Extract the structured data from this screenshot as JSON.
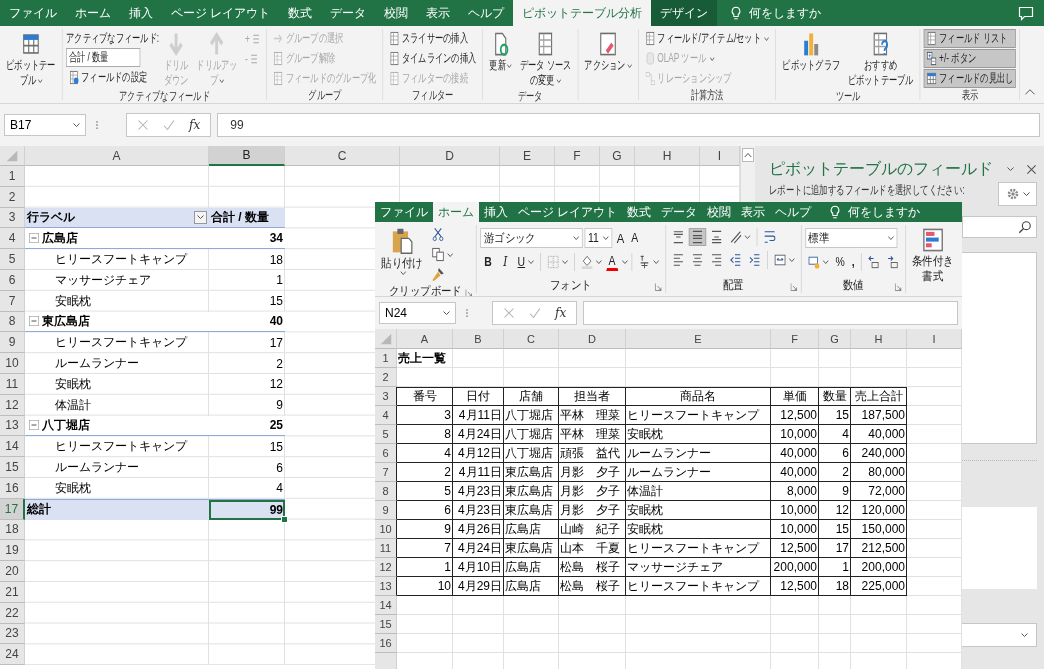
{
  "tabs": [
    {
      "label": "ファイル",
      "kind": "tab",
      "selected": false
    },
    {
      "label": "ホーム",
      "kind": "tab",
      "selected": false
    },
    {
      "label": "挿入",
      "kind": "tab",
      "selected": false
    },
    {
      "label": "ページ レイアウト",
      "kind": "tab",
      "selected": false
    },
    {
      "label": "数式",
      "kind": "tab",
      "selected": false
    },
    {
      "label": "データ",
      "kind": "tab",
      "selected": false
    },
    {
      "label": "校閲",
      "kind": "tab",
      "selected": false
    },
    {
      "label": "表示",
      "kind": "tab",
      "selected": false
    },
    {
      "label": "ヘルプ",
      "kind": "tab",
      "selected": false
    },
    {
      "label": "ピボットテーブル分析",
      "kind": "contextual",
      "selected": true
    },
    {
      "label": "デザイン",
      "kind": "contextual",
      "selected": false
    }
  ],
  "tell_me": "何をしますか",
  "ribbon": {
    "groups": [
      {
        "items": [
          {
            "kind": "large",
            "label": [
              "ピボットテー",
              "ブル"
            ],
            "dropdown": true,
            "disabled": false
          }
        ]
      },
      {
        "label": "アクティブなフィールド",
        "items": [
          {
            "kind": "caption",
            "label": "アクティブなフィールド:"
          },
          {
            "kind": "field",
            "value": "合計 / 数量"
          },
          {
            "kind": "small",
            "label": "フィールドの設定",
            "disabled": false
          },
          {
            "kind": "large",
            "label": [
              "ドリル",
              "ダウン"
            ],
            "disabled": true
          },
          {
            "kind": "large",
            "label": [
              "ドリルアッ",
              "プ"
            ],
            "dropdown": true,
            "disabled": true
          },
          {
            "kind": "glyph",
            "glyph": "+",
            "disabled": true
          },
          {
            "kind": "glyph",
            "glyph": "-",
            "disabled": true
          }
        ]
      },
      {
        "label": "グループ",
        "items": [
          {
            "kind": "small",
            "label": "グループの選択",
            "disabled": true
          },
          {
            "kind": "small",
            "label": "グループ解除",
            "disabled": true
          },
          {
            "kind": "small",
            "label": "フィールドのグループ化",
            "disabled": true
          }
        ]
      },
      {
        "label": "フィルター",
        "items": [
          {
            "kind": "small",
            "label": "スライサーの挿入",
            "disabled": false
          },
          {
            "kind": "small",
            "label": "タイムラインの挿入",
            "disabled": false
          },
          {
            "kind": "small",
            "label": "フィルターの接続",
            "disabled": true
          }
        ]
      },
      {
        "label": "データ",
        "items": [
          {
            "kind": "large",
            "label": [
              "更新"
            ],
            "dropdown": true,
            "disabled": false
          },
          {
            "kind": "large",
            "label": [
              "データ ソース",
              "の変更"
            ],
            "dropdown": true,
            "disabled": false
          }
        ]
      },
      {
        "items": [
          {
            "kind": "large",
            "label": [
              "アクション"
            ],
            "dropdown": true,
            "disabled": false
          }
        ]
      },
      {
        "label": "計算方法",
        "items": [
          {
            "kind": "small",
            "label": "フィールド/アイテム/セット",
            "dropdown": true,
            "disabled": false
          },
          {
            "kind": "small",
            "label": "OLAP ツール",
            "dropdown": true,
            "disabled": true
          },
          {
            "kind": "small",
            "label": "リレーションシップ",
            "disabled": true
          }
        ]
      },
      {
        "label": "ツール",
        "items": [
          {
            "kind": "large",
            "label": [
              "ピボットグラフ"
            ],
            "disabled": false
          },
          {
            "kind": "large",
            "label": [
              "おすすめ",
              "ピボットテーブル"
            ],
            "disabled": false
          }
        ]
      },
      {
        "label": "表示",
        "items": [
          {
            "kind": "toggle",
            "label": "フィールド リスト",
            "on": true,
            "disabled": false
          },
          {
            "kind": "toggle",
            "label": "+/- ボタン",
            "on": true,
            "disabled": false
          },
          {
            "kind": "toggle",
            "label": "フィールドの見出し",
            "on": true,
            "disabled": false
          }
        ]
      }
    ]
  },
  "formula_bar": {
    "name_box": "B17",
    "fx": "fx",
    "value": "99"
  },
  "pivot_sheet": {
    "columns": [
      "A",
      "B",
      "C",
      "D",
      "E",
      "F",
      "G",
      "H",
      "I"
    ],
    "row_numbers": [
      "1",
      "2",
      "3",
      "4",
      "5",
      "6",
      "7",
      "8",
      "9",
      "10",
      "11",
      "12",
      "13",
      "14",
      "15",
      "16",
      "17",
      "18",
      "19",
      "20",
      "21",
      "22",
      "23",
      "24"
    ],
    "header": {
      "row_label": "行ラベル",
      "value_label": "合計 / 数量"
    },
    "groups": [
      {
        "name": "広島店",
        "total": "34",
        "expanded": true,
        "items": [
          {
            "name": "ヒリースフートキャンプ",
            "value": "18"
          },
          {
            "name": "マッサージチェア",
            "value": "1"
          },
          {
            "name": "安眠枕",
            "value": "15"
          }
        ]
      },
      {
        "name": "東広島店",
        "total": "40",
        "expanded": true,
        "items": [
          {
            "name": "ヒリースフートキャンプ",
            "value": "17"
          },
          {
            "name": "ルームランナー",
            "value": "2"
          },
          {
            "name": "安眠枕",
            "value": "12"
          },
          {
            "name": "体温計",
            "value": "9"
          }
        ]
      },
      {
        "name": "八丁堀店",
        "total": "25",
        "expanded": true,
        "items": [
          {
            "name": "ヒリースフートキャンプ",
            "value": "15"
          },
          {
            "name": "ルームランナー",
            "value": "6"
          },
          {
            "name": "安眠枕",
            "value": "4"
          }
        ]
      }
    ],
    "grand_total": {
      "label": "総計",
      "value": "99",
      "selected": true
    }
  },
  "field_pane": {
    "title": "ピボットテーブルのフィールド",
    "subtitle": "レポートに追加するフィールドを選択してください:"
  },
  "data_window": {
    "tabs": [
      {
        "label": "ファイル",
        "kind": "tab",
        "selected": false
      },
      {
        "label": "ホーム",
        "kind": "tab",
        "selected": true
      },
      {
        "label": "挿入",
        "kind": "tab",
        "selected": false
      },
      {
        "label": "ページ レイアウト",
        "kind": "tab",
        "selected": false
      },
      {
        "label": "数式",
        "kind": "tab",
        "selected": false
      },
      {
        "label": "データ",
        "kind": "tab",
        "selected": false
      },
      {
        "label": "校閲",
        "kind": "tab",
        "selected": false
      },
      {
        "label": "表示",
        "kind": "tab",
        "selected": false
      },
      {
        "label": "ヘルプ",
        "kind": "tab",
        "selected": false
      }
    ],
    "tell_me": "何をしますか",
    "ribbon": {
      "groups": [
        "クリップボード",
        "フォント",
        "配置",
        "数値"
      ],
      "paste": "貼り付け",
      "font_name": "游ゴシック",
      "font_size": "11",
      "grow_font": "A",
      "shrink_font": "A",
      "bold": "B",
      "italic": "I",
      "underline": "U",
      "font_color": "A",
      "vertical_align": [
        {
          "selected": false
        },
        {
          "selected": true
        },
        {
          "selected": false
        }
      ],
      "number_format": "標準",
      "percent": "%",
      "comma": ",",
      "conditional_format": [
        "条件付き",
        "書式"
      ]
    },
    "formula_bar": {
      "name_box": "N24",
      "fx": "fx"
    },
    "sheet": {
      "columns": [
        "A",
        "B",
        "C",
        "D",
        "E",
        "F",
        "G",
        "H",
        "I"
      ],
      "row_numbers": [
        "1",
        "2",
        "3",
        "4",
        "5",
        "6",
        "7",
        "8",
        "9",
        "10",
        "11",
        "12",
        "13",
        "14",
        "15",
        "16"
      ],
      "title": "売上一覧",
      "headers": [
        "番号",
        "日付",
        "店舗",
        "担当者",
        "商品名",
        "単価",
        "数量",
        "売上合計"
      ],
      "rows": [
        [
          "3",
          "4月11日",
          "八丁堀店",
          "平林　理菜",
          "ヒリースフートキャンプ",
          "12,500",
          "15",
          "187,500"
        ],
        [
          "8",
          "4月24日",
          "八丁堀店",
          "平林　理菜",
          "安眠枕",
          "10,000",
          "4",
          "40,000"
        ],
        [
          "4",
          "4月12日",
          "八丁堀店",
          "頑張　益代",
          "ルームランナー",
          "40,000",
          "6",
          "240,000"
        ],
        [
          "2",
          "4月11日",
          "東広島店",
          "月影　夕子",
          "ルームランナー",
          "40,000",
          "2",
          "80,000"
        ],
        [
          "5",
          "4月23日",
          "東広島店",
          "月影　夕子",
          "体温計",
          "8,000",
          "9",
          "72,000"
        ],
        [
          "6",
          "4月23日",
          "東広島店",
          "月影　夕子",
          "安眠枕",
          "10,000",
          "12",
          "120,000"
        ],
        [
          "9",
          "4月26日",
          "広島店",
          "山崎　紀子",
          "安眠枕",
          "10,000",
          "15",
          "150,000"
        ],
        [
          "7",
          "4月24日",
          "東広島店",
          "山本　千夏",
          "ヒリースフートキャンプ",
          "12,500",
          "17",
          "212,500"
        ],
        [
          "1",
          "4月10日",
          "広島店",
          "松島　桜子",
          "マッサージチェア",
          "200,000",
          "1",
          "200,000"
        ],
        [
          "10",
          "4月29日",
          "広島店",
          "松島　桜子",
          "ヒリースフートキャンプ",
          "12,500",
          "18",
          "225,000"
        ]
      ]
    }
  }
}
